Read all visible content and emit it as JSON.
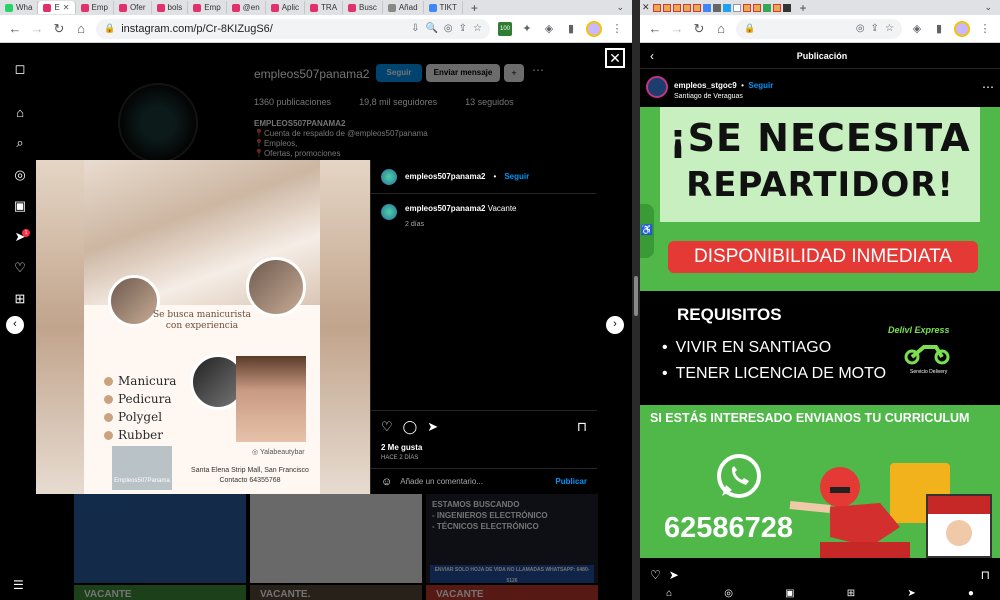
{
  "left": {
    "tabs": [
      {
        "label": "Wha",
        "color": "#25D366"
      },
      {
        "label": "E",
        "color": "#E1306C",
        "active": true
      },
      {
        "label": "Emp",
        "color": "#E1306C"
      },
      {
        "label": "Ofer",
        "color": "#E1306C"
      },
      {
        "label": "bols",
        "color": "#E1306C"
      },
      {
        "label": "Emp",
        "color": "#E1306C"
      },
      {
        "label": "@en",
        "color": "#E1306C"
      },
      {
        "label": "Aplic",
        "color": "#E1306C"
      },
      {
        "label": "TRA",
        "color": "#E1306C"
      },
      {
        "label": "Busc",
        "color": "#E1306C"
      },
      {
        "label": "Añad",
        "color": "#888888"
      },
      {
        "label": "TIKT",
        "color": "#4285F4"
      }
    ],
    "url": "instagram.com/p/Cr-8KIZugS6/",
    "profile": {
      "username": "empleos507panama2",
      "follow_label": "Seguir",
      "message_label": "Enviar mensaje",
      "posts": "1360 publicaciones",
      "followers": "19,8 mil seguidores",
      "following": "13 seguidos",
      "bio_name": "EMPLEOS507PANAMA2",
      "bio_lines": [
        "📍Cuenta de respaldo de @empleos507panama",
        "📍Empleos,",
        "📍Ofertas, promociones"
      ]
    },
    "grid": {
      "cell2_lines": [
        "ESTAMOS BUSCANDO",
        "- INGENIEROS ELECTRÓNICO",
        "- TÉCNICOS ELECTRÓNICO"
      ],
      "cell3_footer": "ENVIAR SOLO HOJA DE VIDA NO LLAMADAS WHATSAPP: 6480-5126",
      "bottom": [
        "VACANTE",
        "VACANTE.",
        "VACANTE"
      ]
    },
    "modal": {
      "user": "empleos507panama2",
      "follow": "Seguir",
      "caption_user": "empleos507panama2",
      "caption_text": "Vacante",
      "caption_time": "2 días",
      "likes": "2 Me gusta",
      "ago": "HACE 2 DÍAS",
      "comment_placeholder": "Añade un comentario...",
      "publish": "Publicar"
    },
    "poster": {
      "title": "Se busca manicurista con experiencia",
      "services": [
        "Manicura",
        "Pedicura",
        "Polygel",
        "Rubber"
      ],
      "instagram": "Yalabeautybar",
      "address": "Santa Elena Strip Mall, San Francisco",
      "contact": "Contacto 64355768",
      "logo": "Empleos507Panama"
    }
  },
  "right": {
    "header_title": "Publicación",
    "user": "empleos_stgoc9",
    "follow": "Seguir",
    "location": "Santiago de Veraguas",
    "ad": {
      "line1": "¡SE NECESITA",
      "line2": "REPARTIDOR!",
      "availability": "DISPONIBILIDAD INMEDIATA",
      "req_title": "REQUISITOS",
      "req": [
        "VIVIR EN SANTIAGO",
        "TENER LICENCIA DE MOTO"
      ],
      "brand": "Delivl Express",
      "brand_sub": "Servicio Delivery",
      "interested": "SI ESTÁS INTERESADO ENVIANOS TU CURRICULUM",
      "phone": "62586728"
    }
  }
}
